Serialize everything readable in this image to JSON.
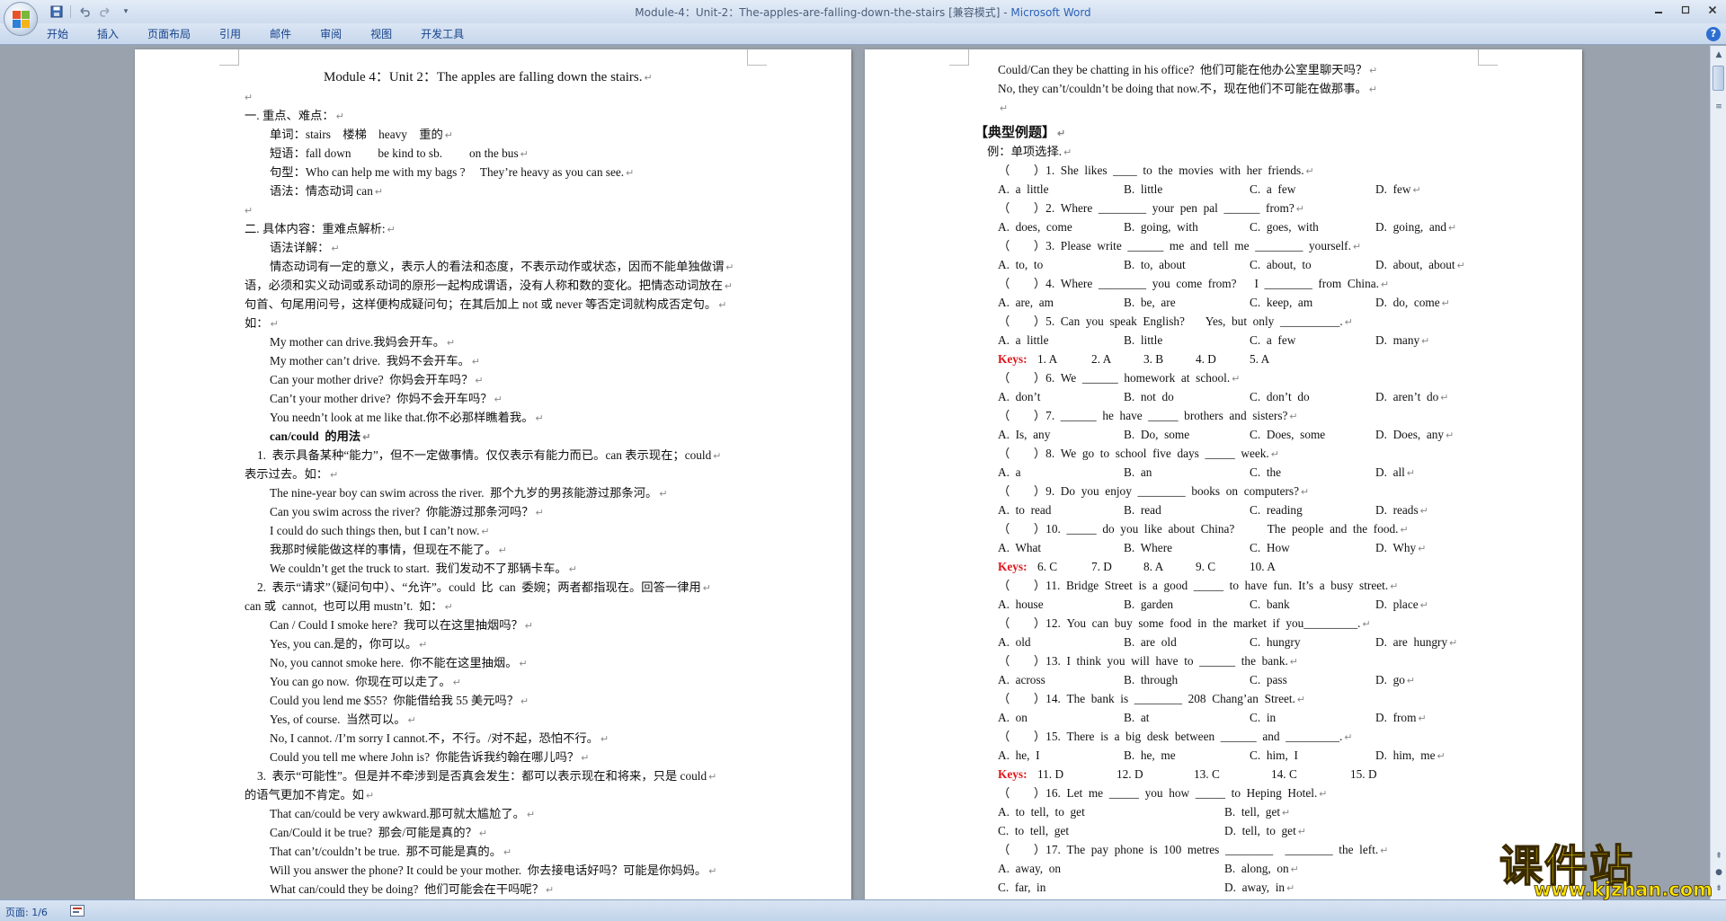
{
  "window": {
    "title": "Module-4：Unit-2：The-apples-are-falling-down-the-stairs [兼容模式] - ",
    "app_name": "Microsoft Word",
    "minimize_icon": "minimize-icon",
    "maximize_icon": "maximize-icon",
    "close_icon": "close-icon"
  },
  "quick_access": {
    "save_icon": "save-icon",
    "undo_icon": "undo-icon",
    "redo_icon": "redo-icon",
    "customize_icon": "chevron-down-icon"
  },
  "ribbon_tabs": [
    "开始",
    "插入",
    "页面布局",
    "引用",
    "邮件",
    "审阅",
    "视图",
    "开发工具"
  ],
  "status_bar": {
    "page_info": "页面: 1/6"
  },
  "watermark": {
    "text": "课件站",
    "url": "www.kjzhan.com"
  },
  "colors": {
    "ribbon": "#c7d7ec",
    "keys_red": "#e0161a",
    "watermark_yellow": "#ffe400",
    "title_blue": "#2a62b6"
  },
  "left_page": {
    "title": "Module 4：Unit 2：The apples are falling down the stairs.",
    "lines": [
      "",
      "一. 重点、难点：",
      "单词：stairs    楼梯    heavy    重的",
      "短语：fall down         be kind to sb.         on the bus",
      "句型：Who can help me with my bags ?     They’re heavy as you can see.",
      "语法：情态动词 can",
      "",
      "二. 具体内容：重难点解析:",
      "语法详解：",
      "情态动词有一定的意义，表示人的看法和态度，不表示动作或状态，因而不能单独做谓",
      "语，必须和实义动词或系动词的原形一起构成谓语，没有人称和数的变化。把情态动词放在",
      "句首、句尾用问号，这样便构成疑问句；在其后加上 not 或 never 等否定词就构成否定句。",
      "如：",
      "My mother can drive.我妈会开车。",
      "My mother can’t drive.  我妈不会开车。",
      "Can your mother drive?  你妈会开车吗？",
      "Can’t your mother drive?  你妈不会开车吗？",
      "You needn’t look at me like that.你不必那样瞧着我。",
      "can/could  的用法",
      "1.  表示具备某种“能力”，但不一定做事情。仅仅表示有能力而已。can 表示现在；could",
      "表示过去。如：",
      "The nine-year boy can swim across the river.  那个九岁的男孩能游过那条河。",
      "Can you swim across the river?  你能游过那条河吗？",
      "I could do such things then, but I can’t now.",
      "我那时候能做这样的事情，但现在不能了。",
      "We couldn’t get the truck to start.  我们发动不了那辆卡车。",
      "2.  表示“请求”（疑问句中）、“允许”。could  比  can  委婉；两者都指现在。回答一律用",
      "can 或  cannot,  也可以用 mustn’t.  如：",
      "Can / Could I smoke here?  我可以在这里抽烟吗？",
      "Yes, you can.是的，你可以。",
      "No, you cannot smoke here.  你不能在这里抽烟。",
      "You can go now.  你现在可以走了。",
      "Could you lend me $55?  你能借给我 55 美元吗？",
      "Yes, of course.  当然可以。",
      "No, I cannot. /I’m sorry I cannot.不，不行。/对不起，恐怕不行。",
      "Could you tell me where John is?  你能告诉我约翰在哪儿吗？",
      "3.  表示“可能性”。但是并不牵涉到是否真会发生：都可以表示现在和将来，只是 could",
      "的语气更加不肯定。如",
      "That can/could be very awkward.那可就太尴尬了。",
      "Can/Could it be true?  那会/可能是真的？",
      "That can’t/couldn’t be true.  那不可能是真的。",
      "Will you answer the phone? It could be your mother.  你去接电话好吗？可能是你妈妈。",
      "What can/could they be doing?  他们可能会在干吗呢？"
    ]
  },
  "right_page": {
    "intro": [
      "Could/Can they be chatting in his office?  他们可能在他办公室里聊天吗？",
      "No, they can’t/couldn’t be doing that now.不，现在他们不可能在做那事。",
      ""
    ],
    "section_title": "【典型例题】",
    "instruction": "例：单项选择.",
    "questions": [
      {
        "q": "（        ）1.  She  likes  ____  to  the  movies  with  her  friends.",
        "opts": [
          "A.  a  little",
          "B.  little",
          "C.  a  few",
          "D.  few"
        ]
      },
      {
        "q": "（        ）2.  Where  ________  your  pen  pal  ______  from?",
        "opts": [
          "A.  does,  come",
          "B.  going,  with",
          "C.  goes,  with",
          "D.  going,  and"
        ]
      },
      {
        "q": "（        ）3.  Please  write  ______  me  and  tell  me  ________  yourself.",
        "opts": [
          "A.  to,  to",
          "B.  to,  about",
          "C.  about,  to",
          "D.  about,  about"
        ]
      },
      {
        "q": "（        ）4.  Where  ________  you  come  from?      I  ________  from  China.",
        "opts": [
          "A.  are,  am",
          "B.  be,  are",
          "C.  keep,  am",
          "D.  do,  come"
        ]
      },
      {
        "q": "（        ）5.  Can  you  speak  English?       Yes,  but  only  __________.",
        "opts": [
          "A.  a  little",
          "B.  little",
          "C.  a  few",
          "D.  many"
        ]
      },
      {
        "keys_label": "Keys:",
        "keys": [
          "1. A",
          "2. A",
          "3. B",
          "4. D",
          "5. A"
        ]
      },
      {
        "q": "（        ）6.  We  ______  homework  at  school.",
        "opts": [
          "A.  don’t",
          "B.  not  do",
          "C.  don’t  do",
          "D.  aren’t  do"
        ]
      },
      {
        "q": "（        ）7.  ______  he  have  _____  brothers  and  sisters?",
        "opts": [
          "A.  Is,  any",
          "B.  Do,  some",
          "C.  Does,  some",
          "D.  Does,  any"
        ]
      },
      {
        "q": "（        ）8.  We  go  to  school  five  days  _____  week.",
        "opts": [
          "A.  a",
          "B.  an",
          "C.  the",
          "D.  all"
        ]
      },
      {
        "q": "（        ）9.  Do  you  enjoy  ________  books  on  computers?",
        "opts": [
          "A.  to  read",
          "B.  read",
          "C.  reading",
          "D.  reads"
        ]
      },
      {
        "q": "（        ）10.  _____  do  you  like  about  China?           The  people  and  the  food.",
        "opts": [
          "A.  What",
          "B.  Where",
          "C.  How",
          "D.  Why"
        ]
      },
      {
        "keys_label": "Keys:",
        "keys": [
          "6. C",
          "7. D",
          "8. A",
          "9. C",
          "10. A"
        ]
      },
      {
        "q": "（        ）11.  Bridge  Street  is  a  good  _____  to  have  fun.  It’s  a  busy  street.",
        "opts": [
          "A.  house",
          "B.  garden",
          "C.  bank",
          "D.  place"
        ]
      },
      {
        "q": "（        ）12.  You  can  buy  some  food  in  the  market  if  you_________.",
        "opts": [
          "A.  old",
          "B.  are  old",
          "C.  hungry",
          "D.  are  hungry"
        ]
      },
      {
        "q": "（        ）13.  I  think  you  will  have  to  ______  the  bank.",
        "opts": [
          "A.  across",
          "B.  through",
          "C.  pass",
          "D.  go"
        ]
      },
      {
        "q": "（        ）14.  The  bank  is  ________  208  Chang’an  Street.",
        "opts": [
          "A.  on",
          "B.  at",
          "C.  in",
          "D.  from"
        ]
      },
      {
        "q": "（        ）15.  There  is  a  big  desk  between  ______  and  _________.",
        "opts": [
          "A.  he,  I",
          "B.  he,  me",
          "C.  him,  I",
          "D.  him,  me"
        ]
      },
      {
        "keys_label": "Keys:",
        "keys": [
          "11. D",
          "12. D",
          "13. C",
          "14. C",
          "15. D"
        ]
      },
      {
        "q": "（        ）16.  Let  me  _____  you  how  _____  to  Heping  Hotel.",
        "opts2": [
          "A.  to  tell,  to  get",
          "B.  tell,  get"
        ],
        "opts3": [
          "C.  to  tell,  get",
          "D.  tell,  to  get"
        ]
      },
      {
        "q": "（        ）17.  The  pay  phone  is  100  metres  ________    ________  the  left.",
        "opts2": [
          "A.  away,  on",
          "B.  along,  on"
        ],
        "opts3": [
          "C.  far,  in",
          "D.  away,  in"
        ]
      }
    ]
  }
}
